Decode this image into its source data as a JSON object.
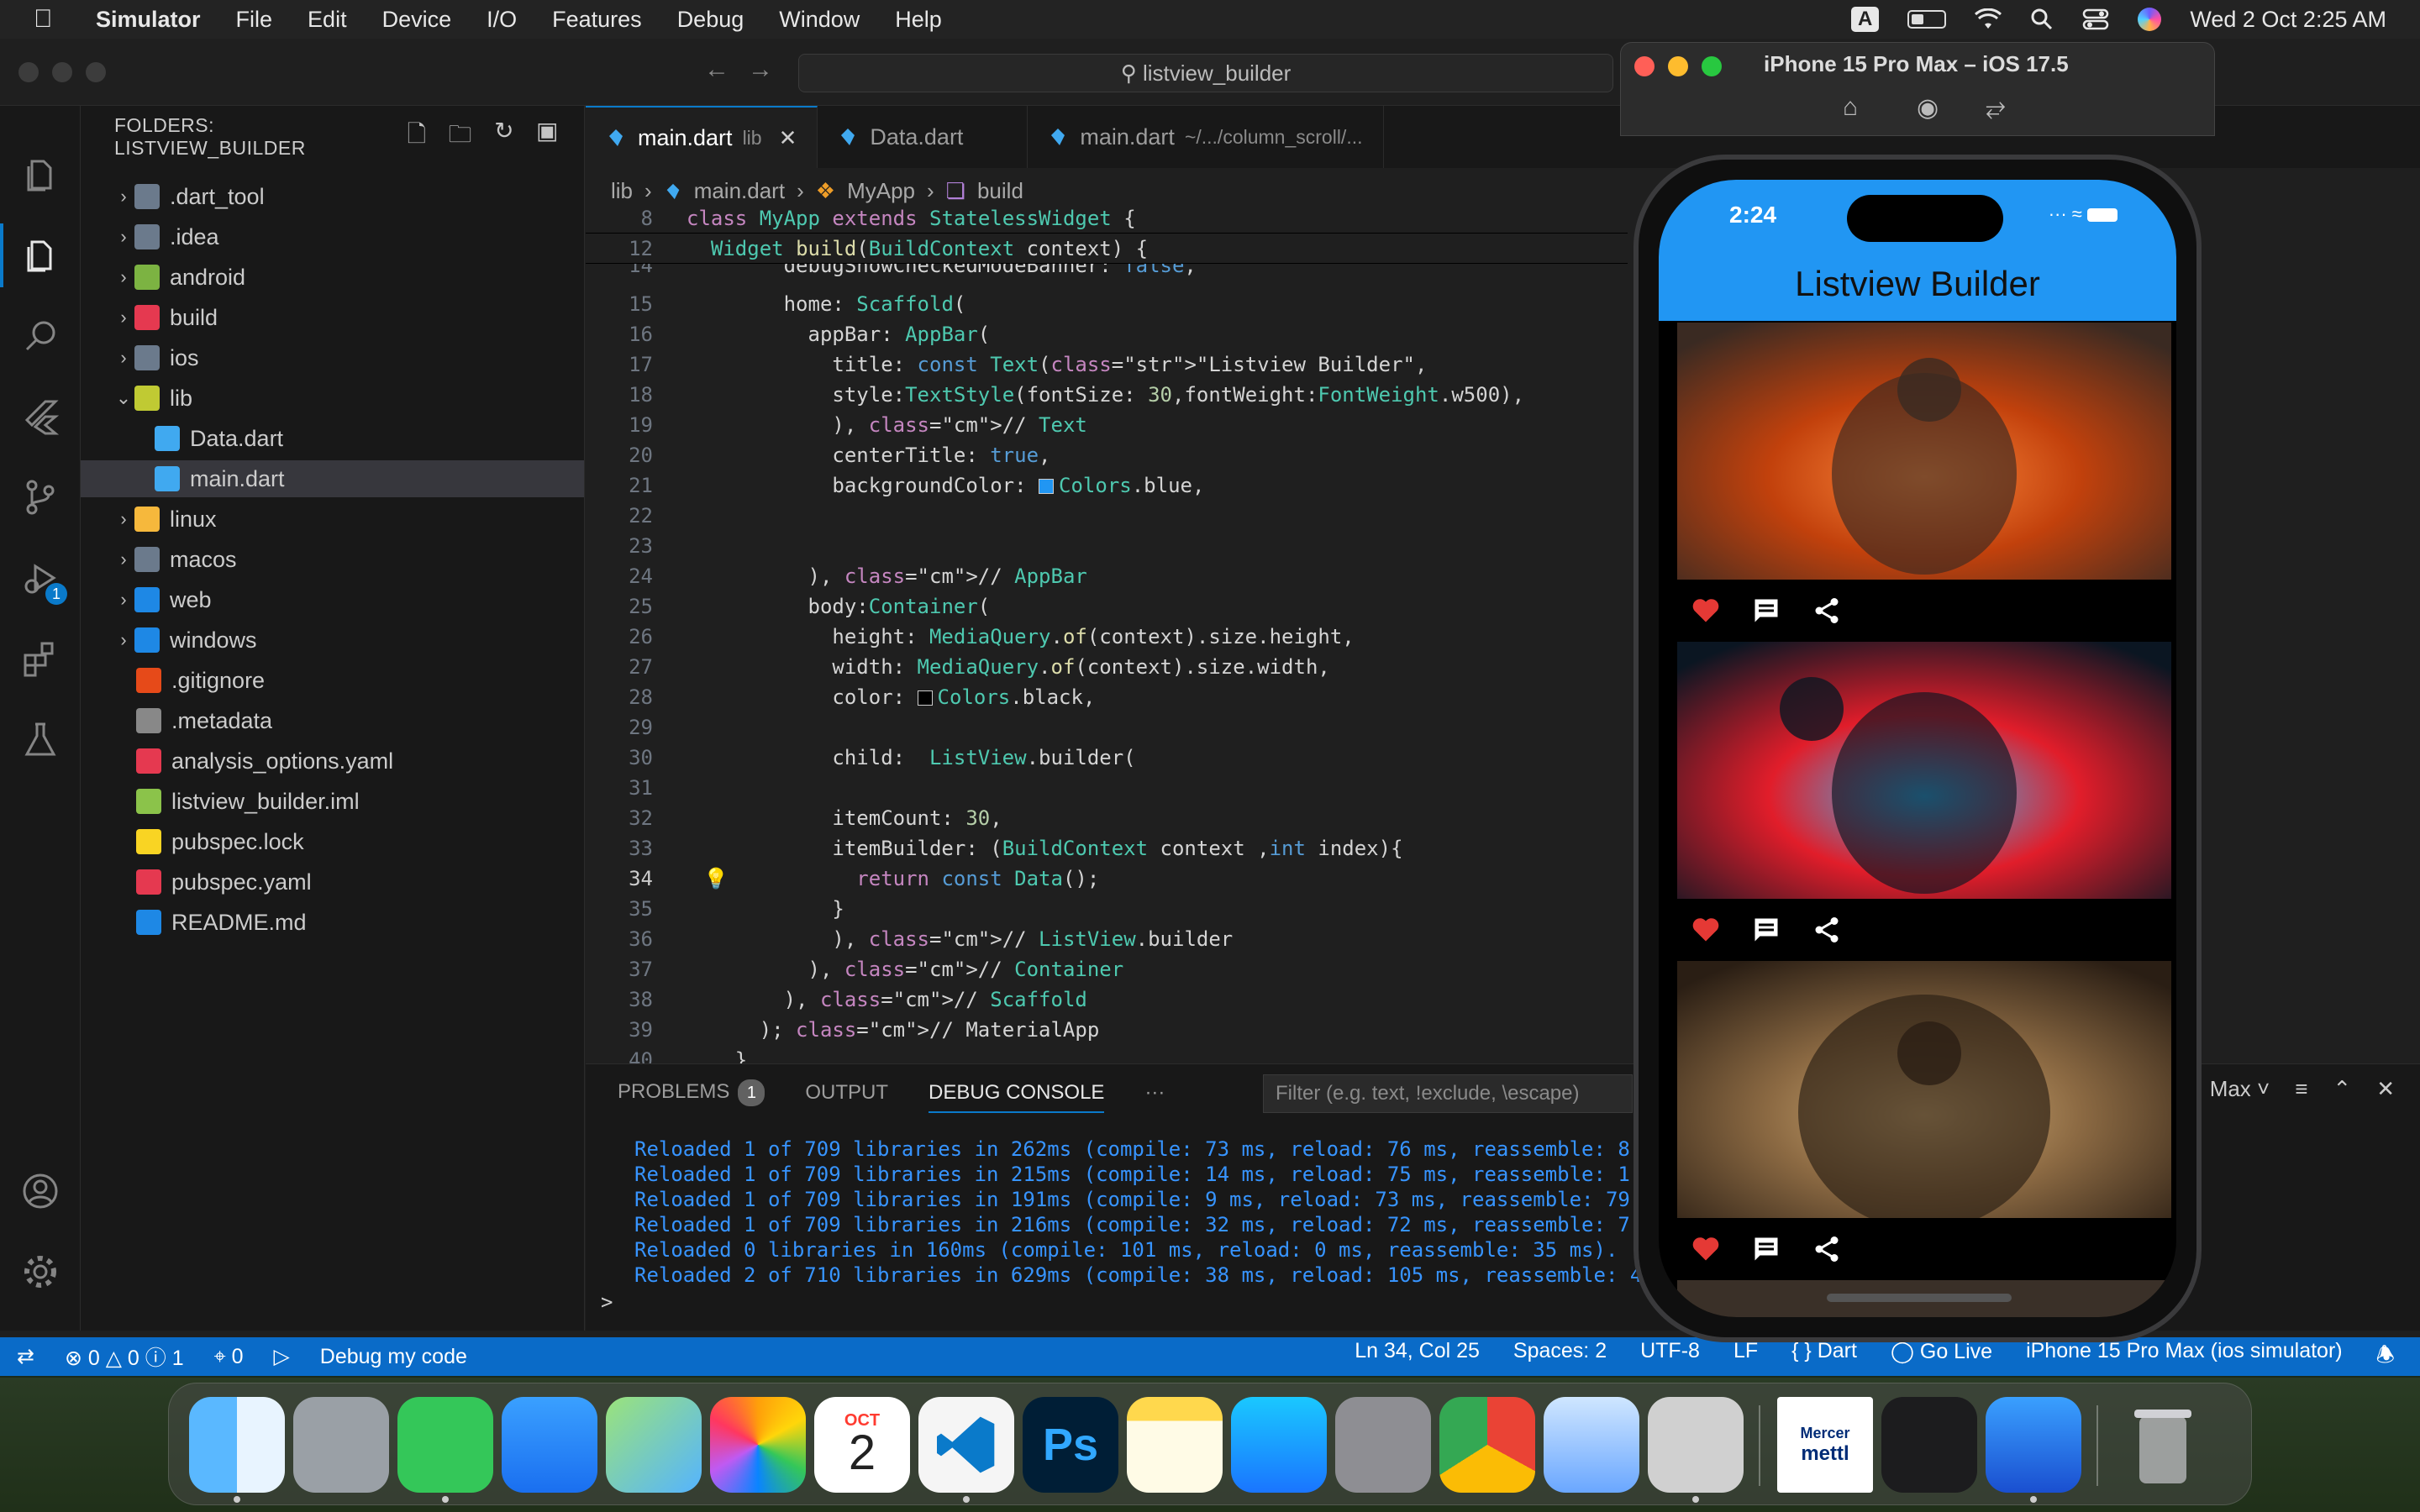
{
  "menubar": {
    "app_name": "Simulator",
    "items": [
      "File",
      "Edit",
      "Device",
      "I/O",
      "Features",
      "Debug",
      "Window",
      "Help"
    ],
    "input_badge": "A",
    "datetime": "Wed 2 Oct  2:25 AM"
  },
  "window": {
    "search_text": "listview_builder"
  },
  "sidebar": {
    "header": "FOLDERS: LISTVIEW_BUILDER",
    "items": [
      {
        "label": ".dart_tool",
        "icon": "folder-icon"
      },
      {
        "label": ".idea",
        "icon": "folder-idea-icon"
      },
      {
        "label": "android",
        "icon": "folder-android-icon"
      },
      {
        "label": "build",
        "icon": "folder-build-icon"
      },
      {
        "label": "ios",
        "icon": "folder-ios-icon"
      },
      {
        "label": "lib",
        "icon": "folder-open-icon"
      },
      {
        "label": "Data.dart",
        "icon": "dart-file-icon"
      },
      {
        "label": "main.dart",
        "icon": "dart-file-icon"
      },
      {
        "label": "linux",
        "icon": "folder-linux-icon"
      },
      {
        "label": "macos",
        "icon": "folder-macos-icon"
      },
      {
        "label": "web",
        "icon": "folder-web-icon"
      },
      {
        "label": "windows",
        "icon": "folder-windows-icon"
      },
      {
        "label": ".gitignore",
        "icon": "git-icon"
      },
      {
        "label": ".metadata",
        "icon": "file-icon"
      },
      {
        "label": "analysis_options.yaml",
        "icon": "yaml-icon"
      },
      {
        "label": "listview_builder.iml",
        "icon": "iml-icon"
      },
      {
        "label": "pubspec.lock",
        "icon": "lock-icon"
      },
      {
        "label": "pubspec.yaml",
        "icon": "yaml-icon"
      },
      {
        "label": "README.md",
        "icon": "info-icon"
      }
    ]
  },
  "tabs": [
    {
      "label": "main.dart",
      "sub": "lib",
      "active": true
    },
    {
      "label": "Data.dart",
      "sub": "",
      "active": false
    },
    {
      "label": "main.dart",
      "sub": "~/.../column_scroll/...",
      "active": false
    }
  ],
  "breadcrumb": [
    "lib",
    "main.dart",
    "MyApp",
    "build"
  ],
  "code": {
    "sticky": [
      {
        "ln": "8",
        "text": "class MyApp extends StatelessWidget {"
      },
      {
        "ln": "12",
        "text": "  Widget build(BuildContext context) {"
      }
    ],
    "lines": [
      {
        "ln": "14",
        "text": "        debugShowCheckedModeBanner: false,"
      },
      {
        "ln": "15",
        "text": "        home: Scaffold("
      },
      {
        "ln": "16",
        "text": "          appBar: AppBar("
      },
      {
        "ln": "17",
        "text": "            title: const Text(\"Listview Builder\","
      },
      {
        "ln": "18",
        "text": "            style:TextStyle(fontSize: 30,fontWeight:FontWeight.w500),"
      },
      {
        "ln": "19",
        "text": "            ), // Text"
      },
      {
        "ln": "20",
        "text": "            centerTitle: true,"
      },
      {
        "ln": "21",
        "text": "            backgroundColor: ▪Colors.blue,"
      },
      {
        "ln": "22",
        "text": ""
      },
      {
        "ln": "23",
        "text": ""
      },
      {
        "ln": "24",
        "text": "          ), // AppBar"
      },
      {
        "ln": "25",
        "text": "          body:Container("
      },
      {
        "ln": "26",
        "text": "            height: MediaQuery.of(context).size.height,"
      },
      {
        "ln": "27",
        "text": "            width: MediaQuery.of(context).size.width,"
      },
      {
        "ln": "28",
        "text": "            color: ▫Colors.black,"
      },
      {
        "ln": "29",
        "text": ""
      },
      {
        "ln": "30",
        "text": "            child:  ListView.builder("
      },
      {
        "ln": "31",
        "text": ""
      },
      {
        "ln": "32",
        "text": "            itemCount: 30,"
      },
      {
        "ln": "33",
        "text": "            itemBuilder: (BuildContext context ,int index){"
      },
      {
        "ln": "34",
        "text": "              return const Data();"
      },
      {
        "ln": "35",
        "text": "            }"
      },
      {
        "ln": "36",
        "text": "            ), // ListView.builder"
      },
      {
        "ln": "37",
        "text": "          ), // Container"
      },
      {
        "ln": "38",
        "text": "        ), // Scaffold"
      },
      {
        "ln": "39",
        "text": "      ); // MaterialApp"
      },
      {
        "ln": "40",
        "text": "    }"
      }
    ]
  },
  "panel": {
    "tabs": [
      "PROBLEMS",
      "OUTPUT",
      "DEBUG CONSOLE"
    ],
    "problems_count": "1",
    "more": "···",
    "filter_placeholder": "Filter (e.g. text, !exclude, \\escape)",
    "filter_dropdown": "Max",
    "console": [
      "Reloaded 1 of 709 libraries in 262ms (compile: 73 ms, reload: 76 ms, reassemble: 8",
      "Reloaded 1 of 709 libraries in 215ms (compile: 14 ms, reload: 75 ms, reassemble: 1",
      "Reloaded 1 of 709 libraries in 191ms (compile: 9 ms, reload: 73 ms, reassemble: 79",
      "Reloaded 1 of 709 libraries in 216ms (compile: 32 ms, reload: 72 ms, reassemble: 7",
      "Reloaded 0 libraries in 160ms (compile: 101 ms, reload: 0 ms, reassemble: 35 ms).",
      "Reloaded 2 of 710 libraries in 629ms (compile: 38 ms, reload: 105 ms, reassemble: 4"
    ],
    "prompt": ">"
  },
  "statusbar": {
    "errors": "0",
    "warnings": "0",
    "infos": "1",
    "ports": "0",
    "debug_label": "Debug my code",
    "position": "Ln 34, Col 25",
    "spaces": "Spaces: 2",
    "encoding": "UTF-8",
    "eol": "LF",
    "language": "Dart",
    "golive": "Go Live",
    "device": "iPhone 15 Pro Max (ios simulator)"
  },
  "simulator": {
    "title": "iPhone 15 Pro Max – iOS 17.5",
    "time": "2:24",
    "app_title": "Listview Builder",
    "cards": [
      {
        "image": "running-man-car-explosion",
        "colors": [
          "#3a2a22",
          "#c2410c",
          "#ff8a3d"
        ]
      },
      {
        "image": "soldiers-neon-street",
        "colors": [
          "#0b1622",
          "#e11d2a",
          "#38bdf8"
        ]
      },
      {
        "image": "spartan-warrior",
        "colors": [
          "#2a1e14",
          "#8c6a43",
          "#d8b27a"
        ]
      }
    ]
  },
  "dock": {
    "calendar_month": "OCT",
    "calendar_day": "2",
    "ps_label": "Ps",
    "mercer_label": "Mercer",
    "mettl_label": "mettl",
    "apps": [
      "finder-icon",
      "launchpad-icon",
      "messages-icon",
      "mail-icon",
      "maps-icon",
      "photos-icon",
      "calendar-icon",
      "vscode-icon",
      "photoshop-icon",
      "notes-icon",
      "app-store-icon",
      "system-settings-icon",
      "chrome-icon",
      "preview-icon",
      "simulator-icon",
      "mercer-mettl-icon",
      "activity-monitor-icon",
      "xcode-icon",
      "trash-icon"
    ]
  }
}
